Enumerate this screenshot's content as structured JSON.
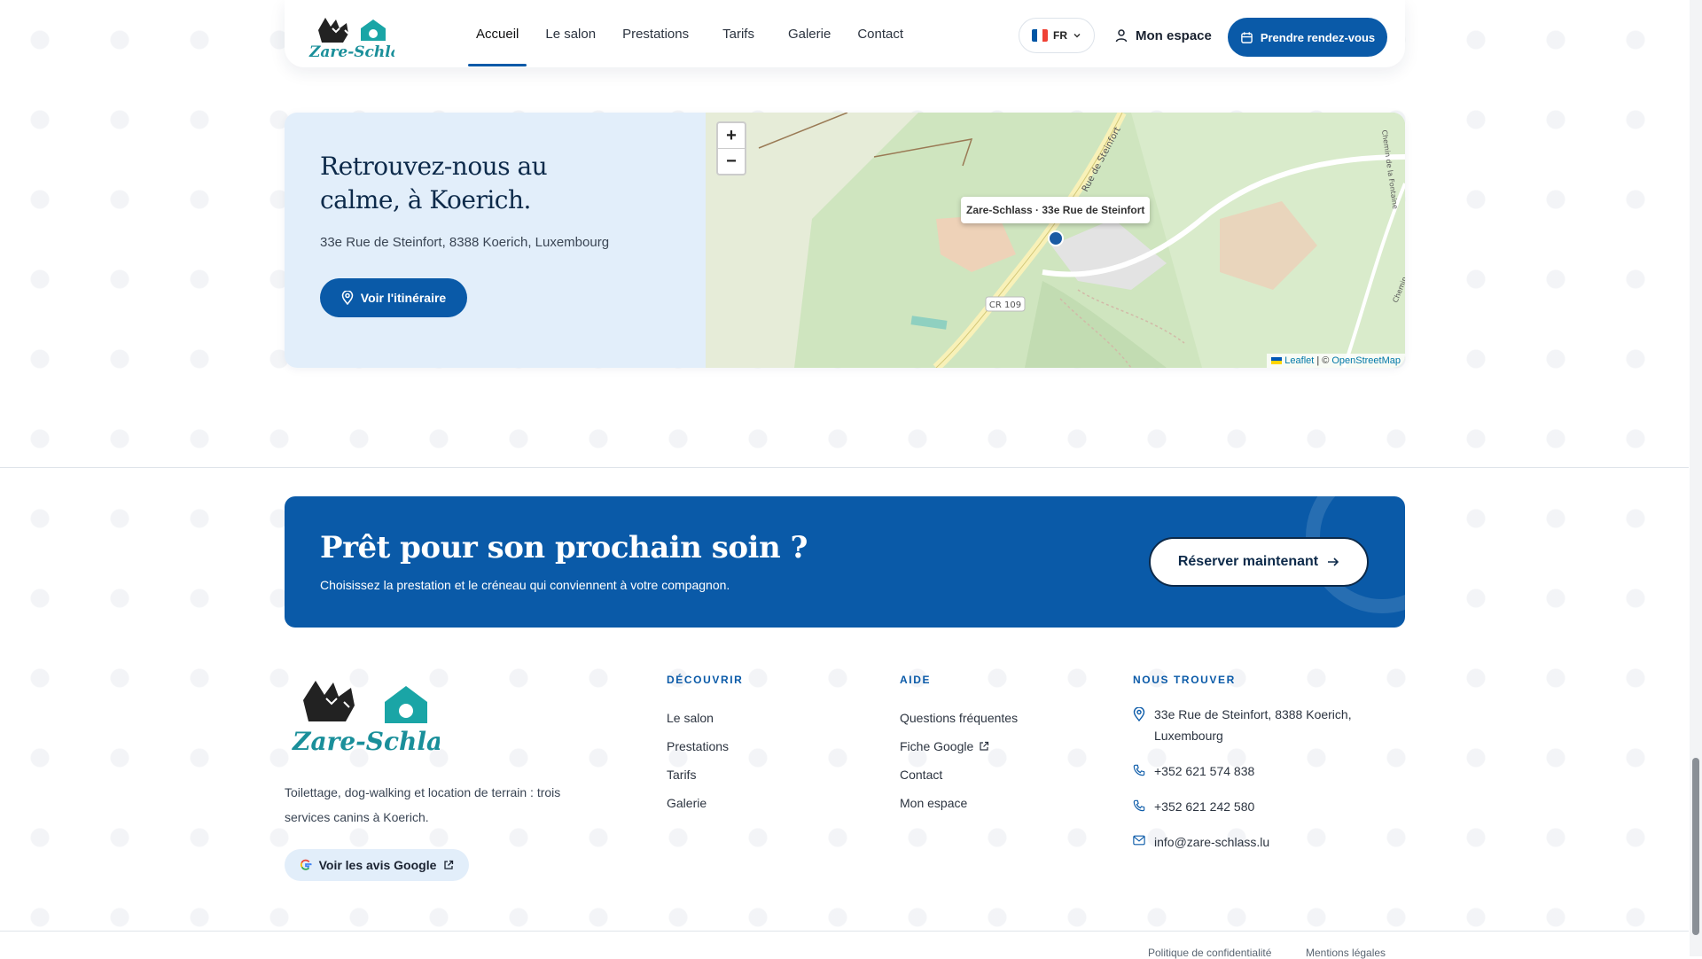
{
  "header": {
    "brand": "Zare-Schlass",
    "nav": [
      {
        "label": "Accueil",
        "active": true
      },
      {
        "label": "Le salon",
        "active": false
      },
      {
        "label": "Prestations",
        "active": false
      },
      {
        "label": "Tarifs",
        "active": false
      },
      {
        "label": "Galerie",
        "active": false
      },
      {
        "label": "Contact",
        "active": false
      }
    ],
    "lang": "FR",
    "my_space": "Mon espace",
    "cta": "Prendre rendez-vous"
  },
  "location": {
    "title_line1": "Retrouvez-nous au",
    "title_line2": "calme, à Koerich.",
    "address": "33e Rue de Steinfort, 8388 Koerich, Luxembourg",
    "button": "Voir l'itinéraire",
    "map": {
      "zoom_in": "+",
      "zoom_out": "−",
      "popup": "Zare-Schlass · 33e Rue de Steinfort",
      "road_label": "CR 109",
      "street_label": "Rue de Steinfort",
      "street_label_2": "Chemin de la Fontaine",
      "street_label_3": "Chemin",
      "attribution_leaflet": "Leaflet",
      "attribution_sep": " | © ",
      "attribution_osm": "OpenStreetMap"
    }
  },
  "banner": {
    "title": "Prêt pour son prochain soin ?",
    "subtitle": "Choisissez la prestation et le créneau qui conviennent à votre compagnon.",
    "button": "Réserver maintenant"
  },
  "footer": {
    "brand": "Zare-Schlass",
    "description": "Toilettage, dog-walking et location de terrain : trois services canins à Koerich.",
    "reviews_button": "Voir les avis Google",
    "discover": {
      "heading": "DÉCOUVRIR",
      "links": [
        "Le salon",
        "Prestations",
        "Tarifs",
        "Galerie"
      ]
    },
    "help": {
      "heading": "AIDE",
      "links": [
        "Questions fréquentes",
        "Fiche Google",
        "Contact",
        "Mon espace"
      ]
    },
    "find": {
      "heading": "NOUS TROUVER",
      "address": "33e Rue de Steinfort, 8388 Koerich, Luxembourg",
      "phone1": "+352 621 574 838",
      "phone2": "+352 621 242 580",
      "email": "info@zare-schlass.lu"
    },
    "legal": [
      "Politique de confidentialité",
      "Mentions légales"
    ]
  },
  "colors": {
    "primary": "#0a5aa8",
    "light_blue": "#e2eefa",
    "brand_teal": "#1aa5a6"
  }
}
